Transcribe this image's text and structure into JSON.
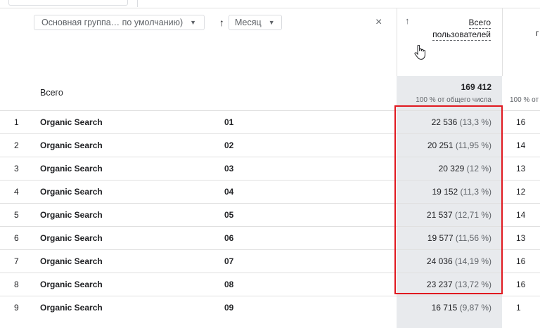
{
  "toolbar": {
    "dimension_primary": "Основная группа… по умолчанию)",
    "dimension_secondary": "Месяц",
    "close_label": "×",
    "sort_arrow": "↑"
  },
  "metric": {
    "sort_arrow": "↑",
    "title_line1": "Всего",
    "title_line2": "пользователей",
    "next_col_partial": "г"
  },
  "totals": {
    "label": "Всего",
    "value": "169 412",
    "sub": "100 % от общего числа",
    "next_sub": "100 % от"
  },
  "rows": [
    {
      "idx": "1",
      "source": "Organic Search",
      "month": "01",
      "value": "22 536",
      "pct": "(13,3 %)",
      "next": "16"
    },
    {
      "idx": "2",
      "source": "Organic Search",
      "month": "02",
      "value": "20 251",
      "pct": "(11,95 %)",
      "next": "14"
    },
    {
      "idx": "3",
      "source": "Organic Search",
      "month": "03",
      "value": "20 329",
      "pct": "(12 %)",
      "next": "13"
    },
    {
      "idx": "4",
      "source": "Organic Search",
      "month": "04",
      "value": "19 152",
      "pct": "(11,3 %)",
      "next": "12"
    },
    {
      "idx": "5",
      "source": "Organic Search",
      "month": "05",
      "value": "21 537",
      "pct": "(12,71 %)",
      "next": "14"
    },
    {
      "idx": "6",
      "source": "Organic Search",
      "month": "06",
      "value": "19 577",
      "pct": "(11,56 %)",
      "next": "13"
    },
    {
      "idx": "7",
      "source": "Organic Search",
      "month": "07",
      "value": "24 036",
      "pct": "(14,19 %)",
      "next": "16"
    },
    {
      "idx": "8",
      "source": "Organic Search",
      "month": "08",
      "value": "23 237",
      "pct": "(13,72 %)",
      "next": "16"
    },
    {
      "idx": "9",
      "source": "Organic Search",
      "month": "09",
      "value": "16 715",
      "pct": "(9,87 %)",
      "next": "1"
    }
  ],
  "colors": {
    "highlight": "#e0181f",
    "metric_column_bg": "#e8eaed"
  },
  "icons": {
    "pointer": "hand-pointer-icon",
    "caret": "chevron-down-icon",
    "close": "close-icon",
    "sort": "arrow-up-icon"
  }
}
